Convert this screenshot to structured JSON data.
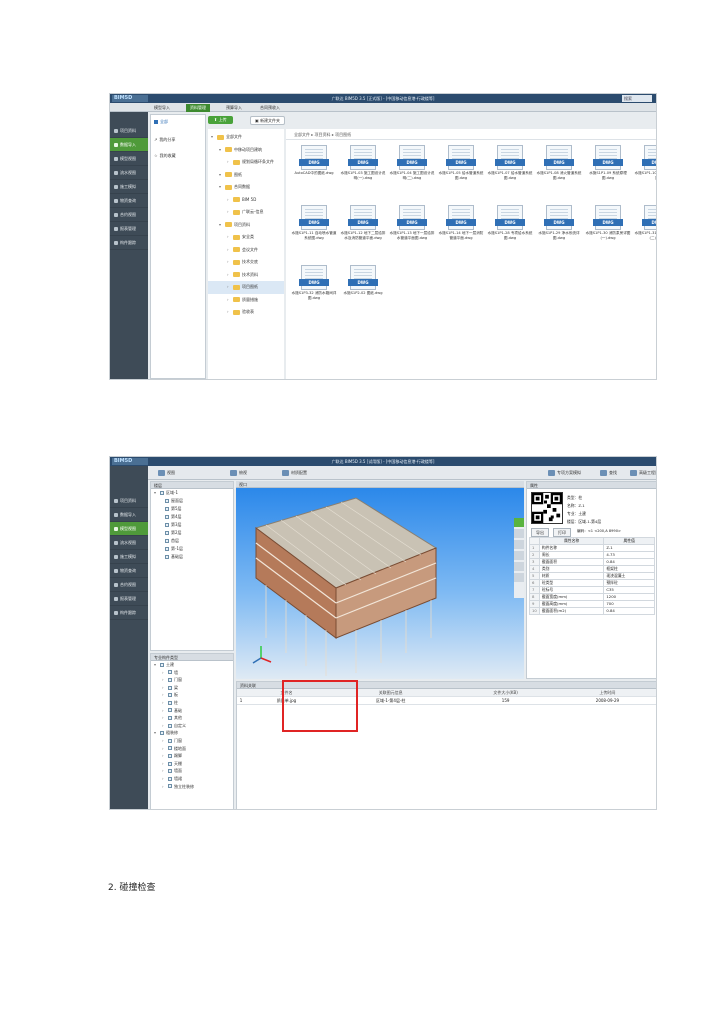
{
  "shot1": {
    "app_logo": "BIM5D",
    "window_title": "广联达 BIM5D 3.5 [正式版] - [中国移动信息港-行政楼等]",
    "search_placeholder": "搜索",
    "menu_tabs": [
      "模型导入",
      "资料管理",
      "预算导入",
      "合同预收入"
    ],
    "active_menu_tab": 1,
    "nav_items": [
      "项目资料",
      "数据导入",
      "模型视图",
      "流水视图",
      "施工模拟",
      "物资查询",
      "合约视图",
      "报表管理",
      "构件跟踪"
    ],
    "active_nav": 1,
    "sidebar": [
      "全部",
      "我的分享",
      "我的收藏"
    ],
    "upload_label": "上传",
    "new_folder_label": "新建文件夹",
    "breadcrumb": "全部文件 ▸ 项目资料 ▸ 项目图纸",
    "tree": [
      {
        "label": "全部文件",
        "level": 0
      },
      {
        "label": "中移动项目建筑",
        "level": 1
      },
      {
        "label": "规划局循环条文件",
        "level": 2
      },
      {
        "label": "图纸",
        "level": 1
      },
      {
        "label": "合同数据",
        "level": 1
      },
      {
        "label": "BIM 5D",
        "level": 2
      },
      {
        "label": "广联云-信息",
        "level": 2
      },
      {
        "label": "项目资料",
        "level": 1
      },
      {
        "label": "安全类",
        "level": 2
      },
      {
        "label": "会议文件",
        "level": 2
      },
      {
        "label": "技术交底",
        "level": 2
      },
      {
        "label": "技术资料",
        "level": 2
      },
      {
        "label": "项目图纸",
        "level": 2
      },
      {
        "label": "质量措施",
        "level": 2
      },
      {
        "label": "验收表",
        "level": 2
      }
    ],
    "file_tag": "DWG",
    "files": [
      "AutoCAD中的图纸.dwg",
      "水施S1P1-03 施工图设计说明(一).dwg",
      "水施S1P1-04 施工图设计说明(二).dwg",
      "水施S1P1-05 给水管道系统图.dwg",
      "水施S1P1-07 给水管道系统图.dwg",
      "水施S1P1-08 消火管道系统图.dwg",
      "水施S1P1-09 系统原理图.dwg",
      "水施S1P1-10 系统管道系统图",
      "水施S1P1-11 自动喷水管道系统图.dwg",
      "水施S1P1-12 地下二层给排水及消防管道平面.dwg",
      "水施S1P1-13 地下一层给排水管道平面图.dwg",
      "水施S1P1-14 地下一层消防管道平面.dwg",
      "水施S1P1-28 专项给水系统图.dwg",
      "水施S1P1-29 净水系统详图.dwg",
      "水施S1P1-30 消防泵房详图(一).dwg",
      "水施S1P1-31 消防泵房详图(二).dwg",
      "水施S1P3-32 消防水箱间详图.dwg",
      "水施S1P2-02 图纸.dwg"
    ]
  },
  "shot2": {
    "app_logo": "BIM5D",
    "window_title": "广联达 BIM5D 3.5 [试用版] - [中国移动信息港-行政楼等]",
    "nav_items": [
      "项目资料",
      "数据导入",
      "模型视图",
      "流水视图",
      "施工模拟",
      "物资查询",
      "合约视图",
      "报表管理",
      "构件跟踪"
    ],
    "active_nav": 2,
    "toolbar": [
      "视图",
      "俯视",
      "材质配置",
      "专项方案模拟",
      "查找",
      "高级工程量"
    ],
    "floor_panel_title": "楼层",
    "floor_root": "区域-1",
    "floors": [
      "屋面层",
      "第5层",
      "第4层",
      "第3层",
      "第2层",
      "首层",
      "第-1层",
      "基础层"
    ],
    "viewport_title": "视口",
    "type_panel_title": "专业构件类型",
    "types": [
      {
        "label": "土建",
        "level": 0
      },
      {
        "label": "墙",
        "level": 1
      },
      {
        "label": "门窗",
        "level": 1
      },
      {
        "label": "梁",
        "level": 1
      },
      {
        "label": "板",
        "level": 1
      },
      {
        "label": "柱",
        "level": 1
      },
      {
        "label": "基础",
        "level": 1
      },
      {
        "label": "其他",
        "level": 1
      },
      {
        "label": "自定义",
        "level": 1
      },
      {
        "label": "粗装修",
        "level": 0
      },
      {
        "label": "门窗",
        "level": 1
      },
      {
        "label": "楼地面",
        "level": 1
      },
      {
        "label": "踢脚",
        "level": 1
      },
      {
        "label": "天棚",
        "level": 1
      },
      {
        "label": "墙面",
        "level": 1
      },
      {
        "label": "墙裙",
        "level": 1
      },
      {
        "label": "独立柱装修",
        "level": 1
      }
    ],
    "props_title": "属性",
    "qr_info": {
      "type": "类型：柱",
      "name": "名称：Z-1",
      "major": "专业：土建",
      "floor": "楼层：区域-1-第4层",
      "code": "编码：<1 <200,A 8990>"
    },
    "props_buttons": [
      "导出",
      "打印"
    ],
    "props_header": [
      "属性名称",
      "属性值"
    ],
    "props": [
      [
        "构件名称",
        "Z-1"
      ],
      [
        "周长",
        "4.73"
      ],
      [
        "截面面积",
        "0.84"
      ],
      [
        "类别",
        "框架柱"
      ],
      [
        "材质",
        "现浇混凝土"
      ],
      [
        "砼类型",
        "预拌砼"
      ],
      [
        "砼标号",
        "C35"
      ],
      [
        "截面宽度(mm)",
        "1200"
      ],
      [
        "截面高度(mm)",
        "700"
      ],
      [
        "截面面积(m2)",
        "0.84"
      ]
    ],
    "files_panel_title": "资料关联",
    "files_header": [
      "文件名",
      "关联图元信息",
      "文件大小(KB)",
      "上传时间"
    ],
    "files_rows": [
      [
        "1",
        "质量单.jpg",
        "区域-1-第4层-柱",
        "159",
        "2008-09-29"
      ]
    ]
  },
  "section_heading": "2. 碰撞检查"
}
